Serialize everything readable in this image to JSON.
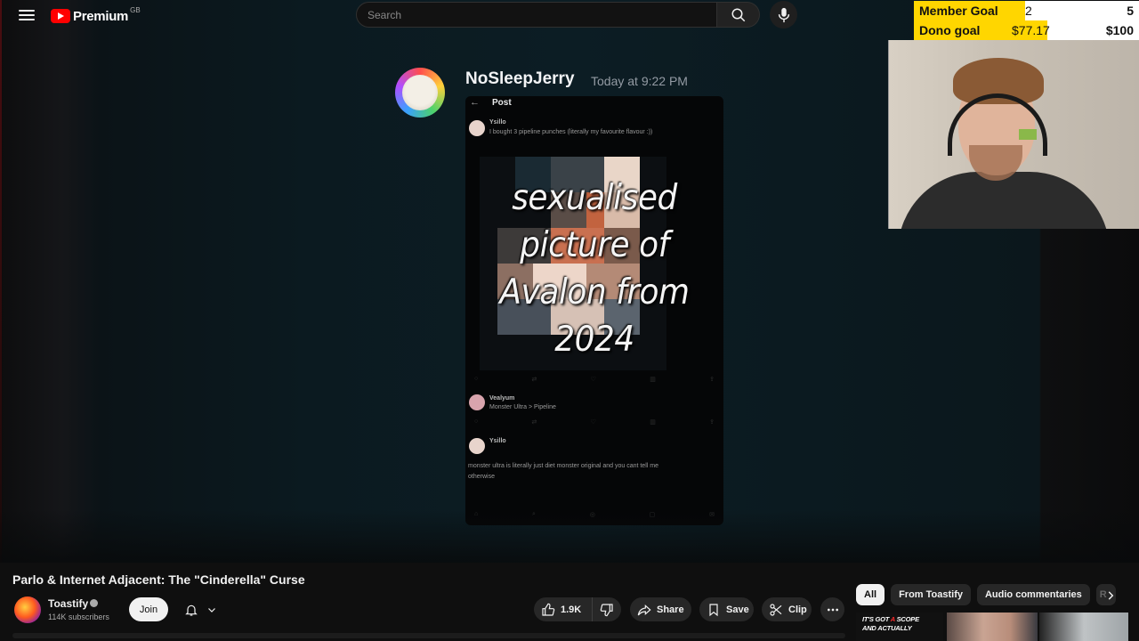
{
  "topbar": {
    "brand": "Premium",
    "region": "GB",
    "search_placeholder": "Search"
  },
  "goals": {
    "member": {
      "label": "Member Goal",
      "current": "2",
      "target": "5",
      "progress": 0.4
    },
    "dono": {
      "label": "Dono goal",
      "current": "$77.17",
      "target": "$100",
      "progress": 0.7717
    }
  },
  "video_content": {
    "message_user": "NoSleepJerry",
    "message_time": "Today at 9:22 PM",
    "post_header": "Post",
    "post1_user": "Ysillo",
    "post1_text": "I bought 3 pipeline punches (literally my favourite flavour :))",
    "overlay_lines": [
      "sexualised",
      "picture of",
      "Avalon from",
      "2024"
    ],
    "reply1_user": "Vealyum",
    "reply1_text": "Monster Ultra > Pipeline",
    "reply2_user": "Ysillo",
    "reply2_text_1": "monster ultra is literally just diet monster original and you cant tell me",
    "reply2_text_2": "otherwise"
  },
  "video_info": {
    "title": "Parlo & Internet Adjacent: The \"Cinderella\" Curse",
    "channel": "Toastify",
    "subscribers": "114K subscribers",
    "join_label": "Join",
    "likes": "1.9K",
    "share_label": "Share",
    "save_label": "Save",
    "clip_label": "Clip"
  },
  "chips": [
    {
      "label": "All",
      "active": true
    },
    {
      "label": "From Toastify"
    },
    {
      "label": "Audio commentaries"
    },
    {
      "label": "R"
    }
  ],
  "thumbnail1_text": {
    "line1_a": "IT'S GOT ",
    "line1_b": "A",
    "line1_c": " SCOPE",
    "line2": "AND ACTUALLY"
  },
  "colors": {
    "youtube_red": "#ff0000",
    "goal_fill": "#ffd600",
    "page_bg": "#0f0f0f"
  }
}
